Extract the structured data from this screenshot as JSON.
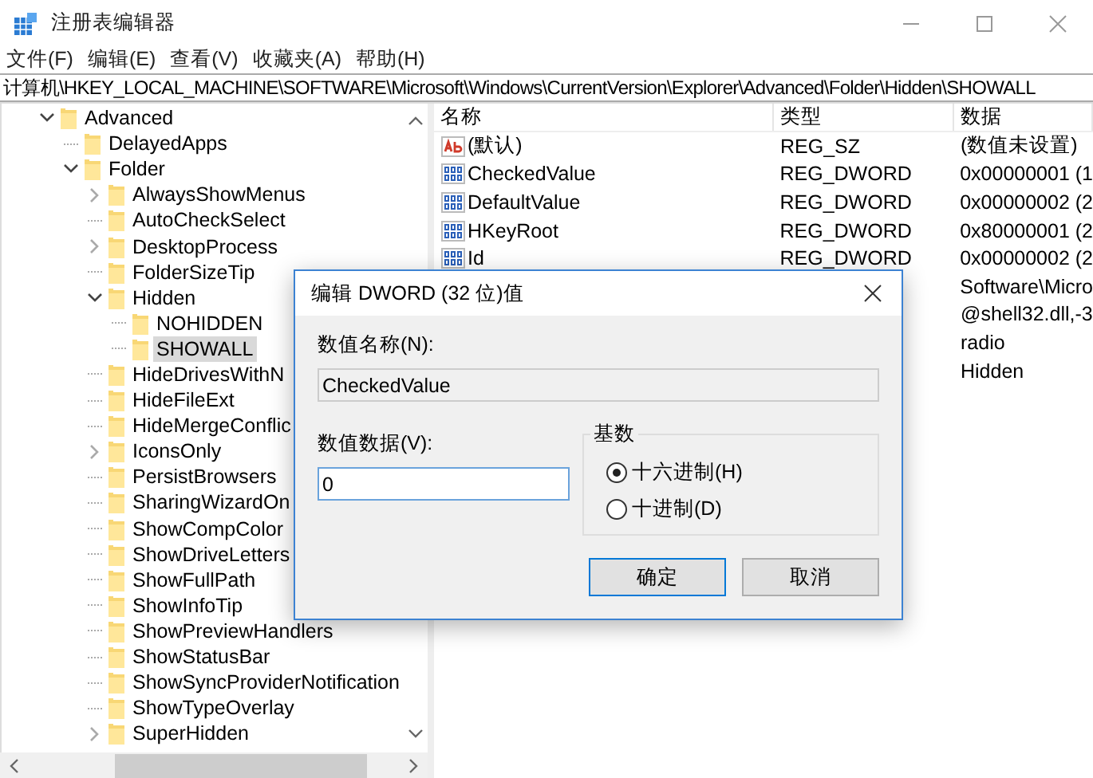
{
  "window": {
    "title": "注册表编辑器"
  },
  "menu": [
    "文件(F)",
    "编辑(E)",
    "查看(V)",
    "收藏夹(A)",
    "帮助(H)"
  ],
  "address": "计算机\\HKEY_LOCAL_MACHINE\\SOFTWARE\\Microsoft\\Windows\\CurrentVersion\\Explorer\\Advanced\\Folder\\Hidden\\SHOWALL",
  "tree": [
    {
      "label": "Advanced",
      "kind": "expanded",
      "selected": false,
      "children": [
        {
          "label": "DelayedApps",
          "kind": "leaf",
          "selected": false
        },
        {
          "label": "Folder",
          "kind": "expanded",
          "selected": false,
          "children": [
            {
              "label": "AlwaysShowMenus",
              "kind": "collapsed",
              "selected": false
            },
            {
              "label": "AutoCheckSelect",
              "kind": "leaf",
              "selected": false
            },
            {
              "label": "DesktopProcess",
              "kind": "collapsed",
              "selected": false
            },
            {
              "label": "FolderSizeTip",
              "kind": "leaf",
              "selected": false
            },
            {
              "label": "Hidden",
              "kind": "expanded",
              "selected": false,
              "children": [
                {
                  "label": "NOHIDDEN",
                  "kind": "leaf",
                  "selected": false
                },
                {
                  "label": "SHOWALL",
                  "kind": "leaf",
                  "selected": true
                }
              ]
            },
            {
              "label": "HideDrivesWithN",
              "kind": "leaf",
              "selected": false
            },
            {
              "label": "HideFileExt",
              "kind": "leaf",
              "selected": false
            },
            {
              "label": "HideMergeConflic",
              "kind": "leaf",
              "selected": false
            },
            {
              "label": "IconsOnly",
              "kind": "collapsed",
              "selected": false
            },
            {
              "label": "PersistBrowsers",
              "kind": "leaf",
              "selected": false
            },
            {
              "label": "SharingWizardOn",
              "kind": "leaf",
              "selected": false
            },
            {
              "label": "ShowCompColor",
              "kind": "leaf",
              "selected": false
            },
            {
              "label": "ShowDriveLetters",
              "kind": "leaf",
              "selected": false
            },
            {
              "label": "ShowFullPath",
              "kind": "leaf",
              "selected": false
            },
            {
              "label": "ShowInfoTip",
              "kind": "leaf",
              "selected": false
            },
            {
              "label": "ShowPreviewHandlers",
              "kind": "leaf",
              "selected": false
            },
            {
              "label": "ShowStatusBar",
              "kind": "leaf",
              "selected": false
            },
            {
              "label": "ShowSyncProviderNotification",
              "kind": "leaf",
              "selected": false
            },
            {
              "label": "ShowTypeOverlay",
              "kind": "leaf",
              "selected": false
            },
            {
              "label": "SuperHidden",
              "kind": "collapsed",
              "selected": false
            }
          ]
        }
      ]
    }
  ],
  "values": {
    "columns": [
      "名称",
      "类型",
      "数据"
    ],
    "rows": [
      {
        "kind": "string",
        "name": "(默认)",
        "type": "REG_SZ",
        "data": "(数值未设置)"
      },
      {
        "kind": "dword",
        "name": "CheckedValue",
        "type": "REG_DWORD",
        "data": "0x00000001 (1"
      },
      {
        "kind": "dword",
        "name": "DefaultValue",
        "type": "REG_DWORD",
        "data": "0x00000002 (2"
      },
      {
        "kind": "dword",
        "name": "HKeyRoot",
        "type": "REG_DWORD",
        "data": "0x80000001 (2"
      },
      {
        "kind": "dword",
        "name": "Id",
        "type": "REG_DWORD",
        "data": "0x00000002 (2"
      },
      {
        "kind": "hidden",
        "data": "Software\\Micro"
      },
      {
        "kind": "hidden",
        "data": "@shell32.dll,-3"
      },
      {
        "kind": "hidden",
        "data": "radio"
      },
      {
        "kind": "hidden",
        "data": "Hidden"
      }
    ]
  },
  "dialog": {
    "title": "编辑 DWORD (32 位)值",
    "name_label": "数值名称(N):",
    "name_value": "CheckedValue",
    "data_label": "数值数据(V):",
    "data_value": "0",
    "base_label": "基数",
    "bases": [
      {
        "label": "十六进制(H)",
        "selected": true
      },
      {
        "label": "十进制(D)",
        "selected": false
      }
    ],
    "buttons": [
      {
        "label": "确定",
        "kind": "default"
      },
      {
        "label": "取消",
        "kind": "normal"
      }
    ]
  }
}
